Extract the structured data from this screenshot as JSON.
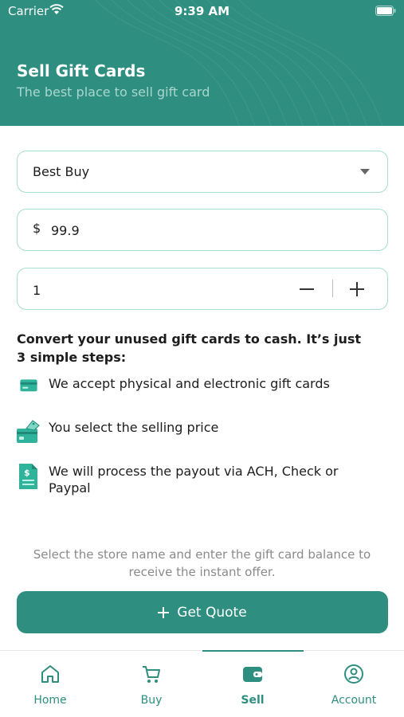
{
  "status_bar": {
    "carrier": "Carrier",
    "time": "9:39 AM"
  },
  "header": {
    "title": "Sell Gift Cards",
    "subtitle": "The best place to sell gift card",
    "color": "#2e8f80"
  },
  "form": {
    "store": {
      "selected": "Best Buy",
      "icon": "caret-down-icon"
    },
    "amount": {
      "currency": "$",
      "value": "99.9"
    },
    "quantity": {
      "value": "1",
      "decrement_icon": "minus-icon",
      "increment_icon": "plus-icon"
    }
  },
  "steps": {
    "intro": "Convert your unused gift cards to cash. It’s just 3 simple steps:",
    "items": [
      {
        "icon": "credit-card-icon",
        "text": "We accept physical and electronic gift cards"
      },
      {
        "icon": "price-tag-card-icon",
        "text": "You select the selling price"
      },
      {
        "icon": "dollar-document-icon",
        "text": "We will process the payout via ACH, Check or Paypal"
      }
    ]
  },
  "hint": "Select the store name and enter the gift card balance to receive the instant offer.",
  "quote_button": {
    "label": "Get Quote",
    "icon": "plus-icon"
  },
  "tabbar": {
    "active": "Sell",
    "tabs": [
      {
        "label": "Home",
        "icon": "home-icon"
      },
      {
        "label": "Buy",
        "icon": "cart-icon"
      },
      {
        "label": "Sell",
        "icon": "wallet-icon"
      },
      {
        "label": "Account",
        "icon": "user-circle-icon"
      }
    ]
  },
  "colors": {
    "accent": "#2e8f80",
    "field_border": "#a8dccf",
    "hint_text": "#8a8a8a"
  }
}
